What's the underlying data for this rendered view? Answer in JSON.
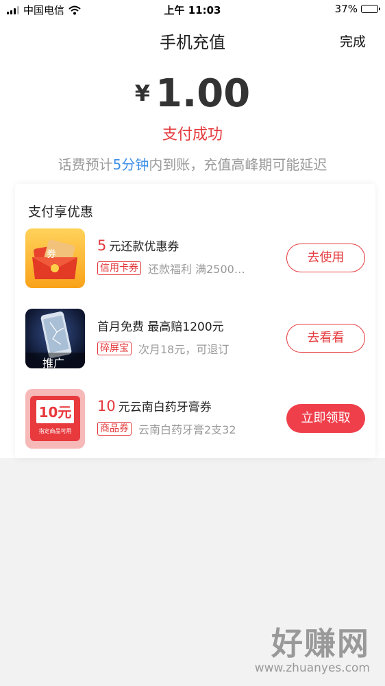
{
  "status_bar": {
    "carrier": "中国电信",
    "time": "上午 11:03",
    "battery": "37%",
    "battery_level": 0.37
  },
  "nav": {
    "title": "手机充值",
    "done_label": "完成"
  },
  "payment": {
    "currency": "¥",
    "amount": "1.00",
    "status": "支付成功",
    "notice_pre": "话费预计",
    "notice_highlight": "5分钟",
    "notice_post": "内到账，充值高峰期可能延迟"
  },
  "offers_section": {
    "title": "支付享优惠",
    "items": [
      {
        "title_num": "5",
        "title_text": "元还款优惠券",
        "tag": "信用卡券",
        "desc": "还款福利 满2500…",
        "button": "去使用",
        "button_style": "outline",
        "thumb_text": "券",
        "icon": "red-envelope-coupon-icon"
      },
      {
        "title_num": "",
        "title_text": "首月免费 最高赔1200元",
        "tag": "碎屏宝",
        "desc": "次月18元，可退订",
        "button": "去看看",
        "button_style": "outline",
        "thumb_text": "推广",
        "icon": "cracked-phone-icon"
      },
      {
        "title_num": "10",
        "title_text": "元云南白药牙膏券",
        "tag": "商品券",
        "desc": "云南白药牙膏2支32",
        "button": "立即领取",
        "button_style": "solid",
        "thumb_text": "10元",
        "thumb_subtext": "指定商品可用",
        "icon": "toothpaste-coupon-icon"
      }
    ]
  },
  "watermark": {
    "title": "好赚网",
    "url": "www.zhuanyes.com"
  },
  "colors": {
    "accent": "#e4393c",
    "link": "#3d8ee8",
    "button_solid": "#ef3f4b",
    "page_bg": "#f2f2f2"
  }
}
